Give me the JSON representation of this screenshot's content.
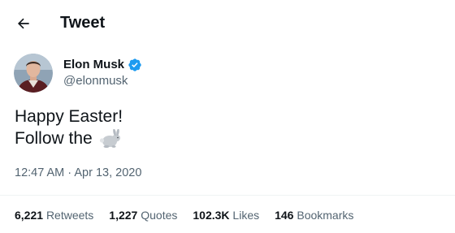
{
  "header": {
    "title": "Tweet",
    "back_icon": "arrow-left-icon"
  },
  "author": {
    "name": "Elon Musk",
    "handle": "@elonmusk",
    "verified_icon": "verified-badge-icon",
    "verified_color": "#1d9bf0"
  },
  "tweet": {
    "line1": "Happy Easter!",
    "line2": "Follow the",
    "emoji": "rabbit-icon",
    "timestamp": "12:47 AM · Apr 13, 2020"
  },
  "stats": [
    {
      "count": "6,221",
      "label": "Retweets"
    },
    {
      "count": "1,227",
      "label": "Quotes"
    },
    {
      "count": "102.3K",
      "label": "Likes"
    },
    {
      "count": "146",
      "label": "Bookmarks"
    }
  ],
  "colors": {
    "text": "#0f1419",
    "secondary": "#536471",
    "divider": "#eff3f4"
  }
}
